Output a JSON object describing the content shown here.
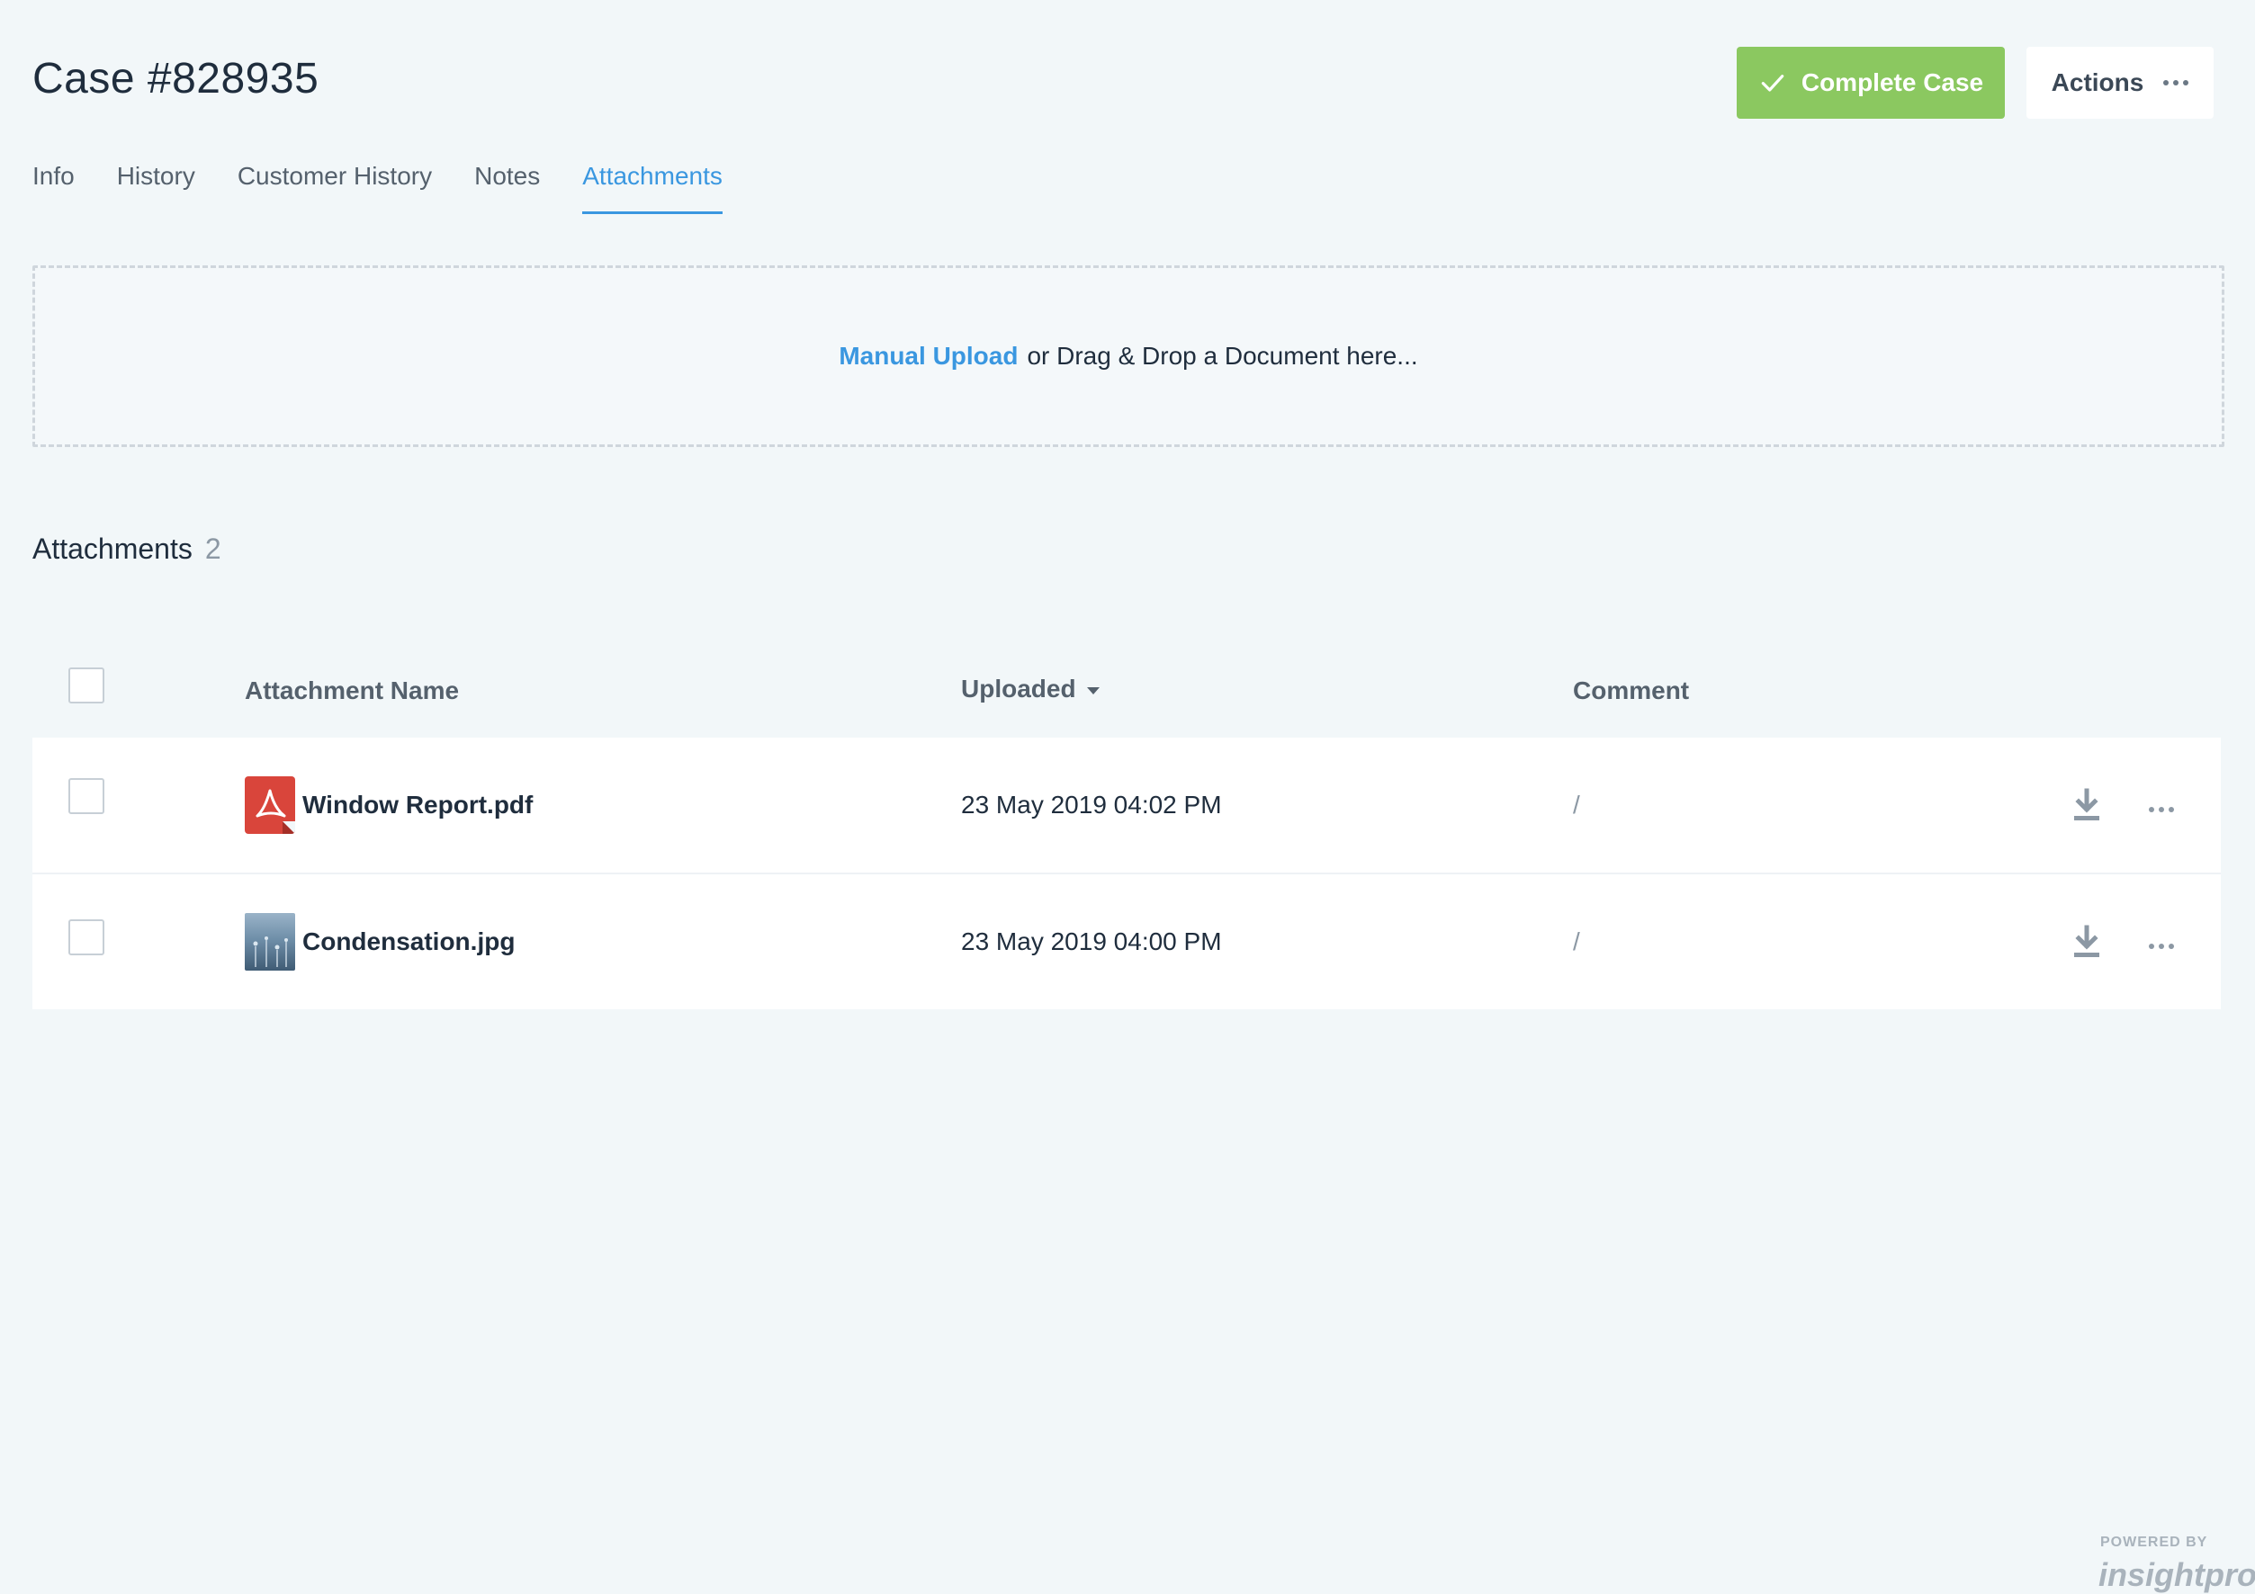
{
  "header": {
    "title": "Case #828935",
    "complete_label": "Complete Case",
    "actions_label": "Actions"
  },
  "tabs": [
    {
      "label": "Info"
    },
    {
      "label": "History"
    },
    {
      "label": "Customer History"
    },
    {
      "label": "Notes"
    },
    {
      "label": "Attachments",
      "active": true
    }
  ],
  "dropzone": {
    "link_label": "Manual Upload",
    "text": "or Drag & Drop a Document here..."
  },
  "attachments": {
    "title": "Attachments",
    "count": "2",
    "columns": {
      "name": "Attachment Name",
      "uploaded": "Uploaded",
      "comment": "Comment"
    },
    "rows": [
      {
        "name": "Window Report.pdf",
        "uploaded": "23 May 2019 04:02 PM",
        "comment": "/",
        "icon": "pdf-file-icon"
      },
      {
        "name": "Condensation.jpg",
        "uploaded": "23 May 2019 04:00 PM",
        "comment": "/",
        "icon": "image-thumbnail"
      }
    ]
  },
  "footer": {
    "powered_by": "POWERED BY",
    "brand": "insightpro"
  },
  "colors": {
    "accent": "#3a97e0",
    "complete_green": "#8bc860",
    "background": "#f2f7f9",
    "pdf_red": "#d9453b"
  }
}
